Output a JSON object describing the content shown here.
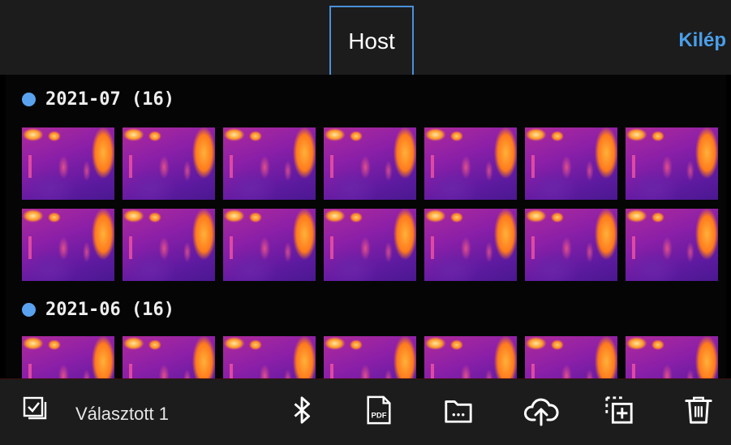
{
  "header": {
    "tab_label": "Host",
    "exit_label": "Kilép"
  },
  "gallery": {
    "groups": [
      {
        "label": "2021-07  (16)",
        "rows_visible": 2
      },
      {
        "label": "2021-06  (16)",
        "rows_visible": 1
      }
    ],
    "thumbnail_type": "thermal-image"
  },
  "bottom_bar": {
    "selected_label": "Választott 1",
    "actions": [
      {
        "icon": "bluetooth-icon"
      },
      {
        "icon": "pdf-icon",
        "text": "PDF"
      },
      {
        "icon": "folder-icon"
      },
      {
        "icon": "cloud-upload-icon"
      },
      {
        "icon": "copy-add-icon"
      },
      {
        "icon": "trash-icon"
      }
    ]
  },
  "colors": {
    "accent": "#4a9fea",
    "bar_background": "#1c1c1c",
    "background": "#000000"
  }
}
